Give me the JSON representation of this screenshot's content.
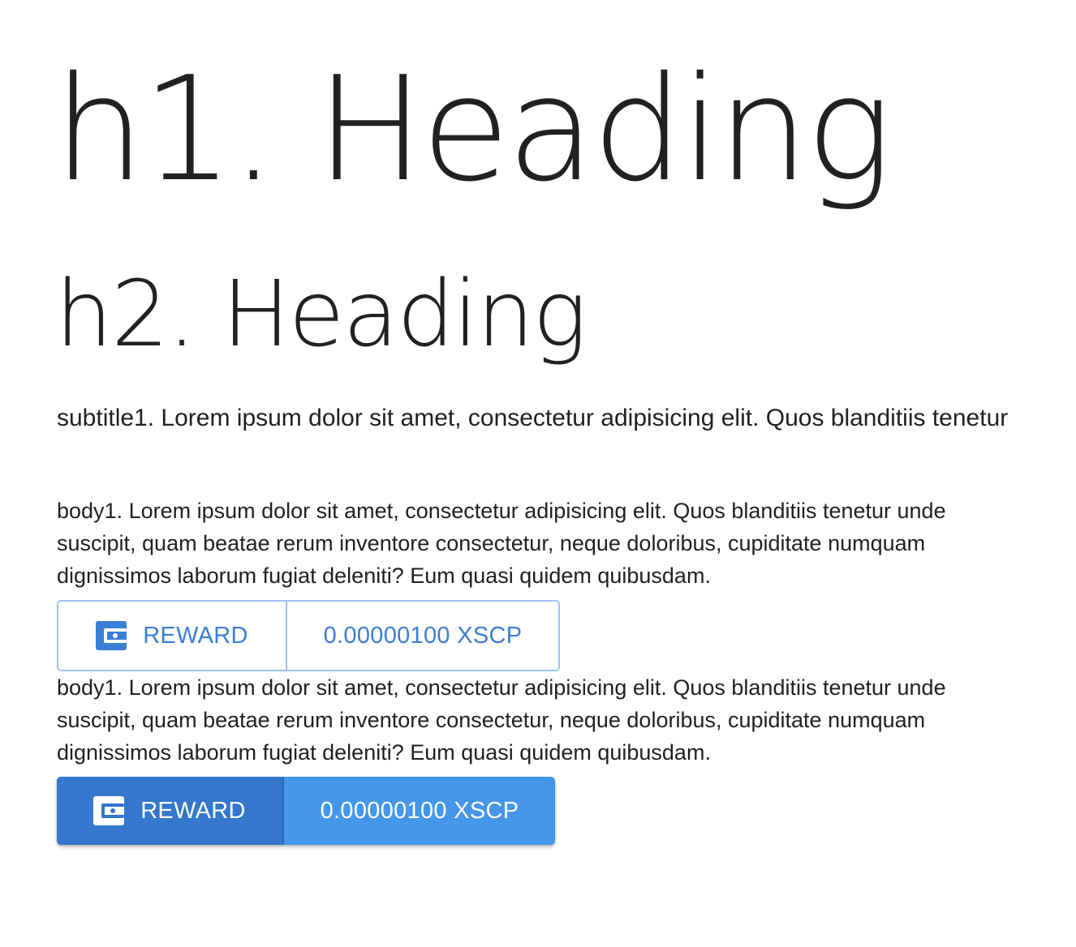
{
  "headings": {
    "h1": "h1. Heading",
    "h2": "h2. Heading"
  },
  "subtitle1": "subtitle1. Lorem ipsum dolor sit amet, consectetur adipisicing elit. Quos blanditiis tenetur",
  "body1_first": "body1. Lorem ipsum dolor sit amet, consectetur adipisicing elit. Quos blanditiis tenetur unde suscipit, quam beatae rerum inventore consectetur, neque doloribus, cupiditate numquam dignissimos laborum fugiat deleniti? Eum quasi quidem quibusdam.",
  "body1_second": "body1. Lorem ipsum dolor sit amet, consectetur adipisicing elit. Quos blanditiis tenetur unde suscipit, quam beatae rerum inventore consectetur, neque doloribus, cupiditate numquam dignissimos laborum fugiat deleniti? Eum quasi quidem quibusdam.",
  "reward_outlined": {
    "icon": "wallet-icon",
    "label": "REWARD",
    "amount": "0.00000100 XSCP"
  },
  "reward_contained": {
    "icon": "wallet-icon",
    "label": "REWARD",
    "amount": "0.00000100 XSCP"
  },
  "colors": {
    "text": "#212121",
    "primary": "#3a7fd6",
    "primary_dark": "#3477cc",
    "primary_light": "#4597ea",
    "outline": "#9fc3f0",
    "background": "#ffffff"
  }
}
